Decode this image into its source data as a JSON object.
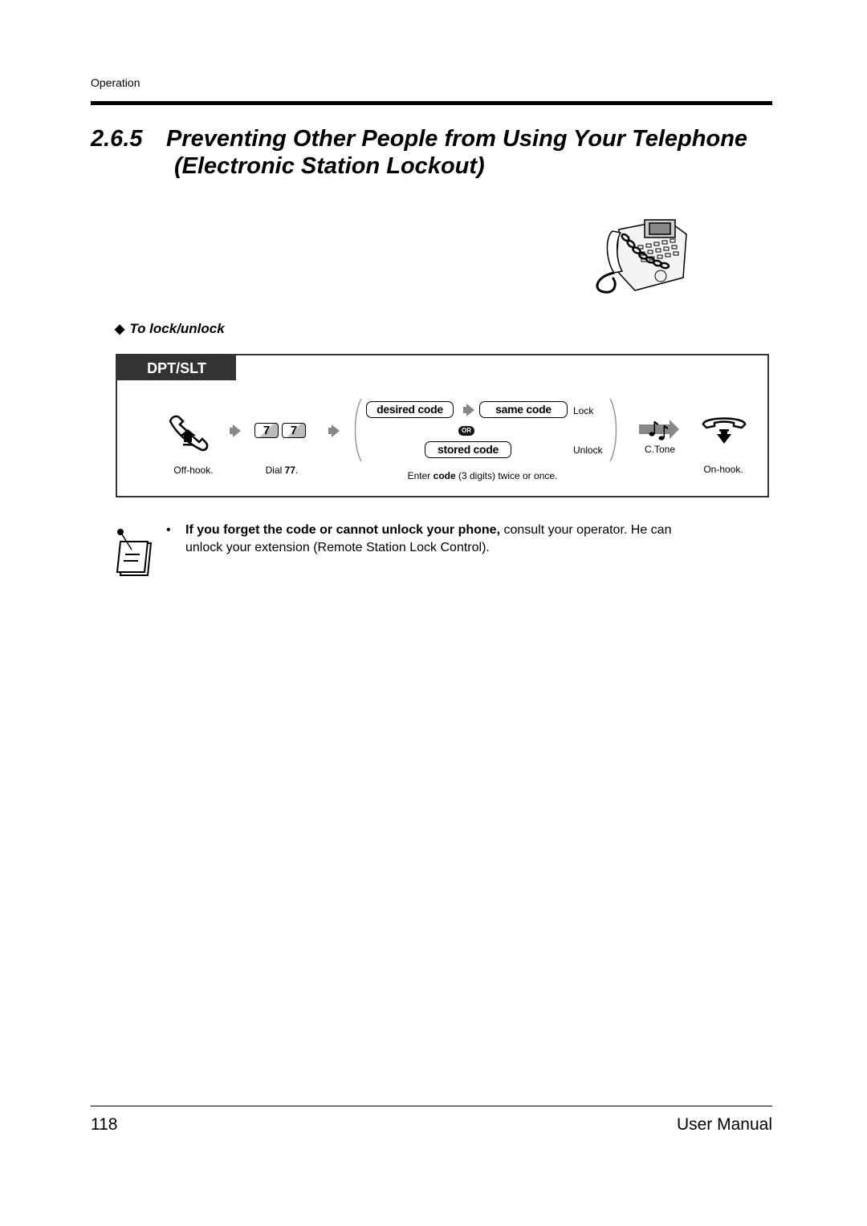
{
  "header": {
    "section_label": "Operation"
  },
  "title": {
    "number": "2.6.5",
    "line1": "Preventing Other People from Using Your Telephone",
    "line2": "(Electronic Station Lockout)"
  },
  "illustration": {
    "icon": "locked-telephone-with-chain"
  },
  "subheading": {
    "bullet": "◆",
    "text": "To lock/unlock"
  },
  "procedure": {
    "tab_label": "DPT/SLT",
    "steps": [
      {
        "icon": "off-hook-icon",
        "label": "Off-hook."
      },
      {
        "keys": [
          "7",
          "7"
        ],
        "label_prefix": "Dial ",
        "label_bold": "77",
        "label_suffix": "."
      },
      {
        "lock_row": {
          "first": "desired code",
          "second": "same code",
          "result": "Lock"
        },
        "or_label": "OR",
        "unlock_row": {
          "code": "stored code",
          "result": "Unlock"
        },
        "label_prefix": "Enter ",
        "label_bold": "code",
        "label_suffix": " (3 digits) twice or once."
      },
      {
        "icon": "confirmation-tone-icon",
        "label": "C.Tone"
      },
      {
        "icon": "on-hook-icon",
        "label": "On-hook."
      }
    ]
  },
  "note": {
    "icon": "note-pad-icon",
    "bullet": "•",
    "bold_text": "If you forget the code or cannot unlock your phone,",
    "text_line1": " consult your operator. He can",
    "text_line2": "unlock your extension (Remote Station Lock Control)."
  },
  "footer": {
    "page_number": "118",
    "title": "User Manual"
  }
}
